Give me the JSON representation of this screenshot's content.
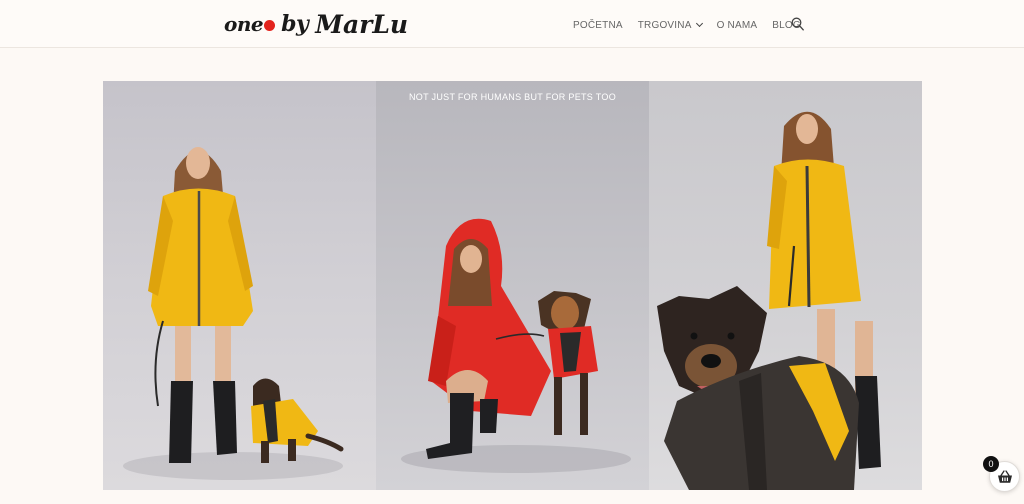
{
  "brand": {
    "logo_one": "one",
    "logo_by": "by",
    "logo_marlu": "MarLu",
    "dot_color": "#e3231d"
  },
  "nav": {
    "items": [
      {
        "label": "POČETNA"
      },
      {
        "label": "TRGOVINA",
        "has_dropdown": true
      },
      {
        "label": "O NAMA"
      },
      {
        "label": "BLOG"
      }
    ],
    "search_icon": "search-icon"
  },
  "gallery": {
    "caption": "NOT JUST FOR HUMANS BUT FOR PETS TOO",
    "photos": [
      {
        "alt": "woman-yellow-raincoat-dog",
        "coat_color": "#f0b814"
      },
      {
        "alt": "woman-red-raincoat-dog",
        "coat_color": "#e02b25"
      },
      {
        "alt": "woman-yellow-raincoat-dog-closeup",
        "coat_color": "#f0b814"
      }
    ]
  },
  "cart": {
    "count": "0",
    "icon": "basket-icon"
  }
}
